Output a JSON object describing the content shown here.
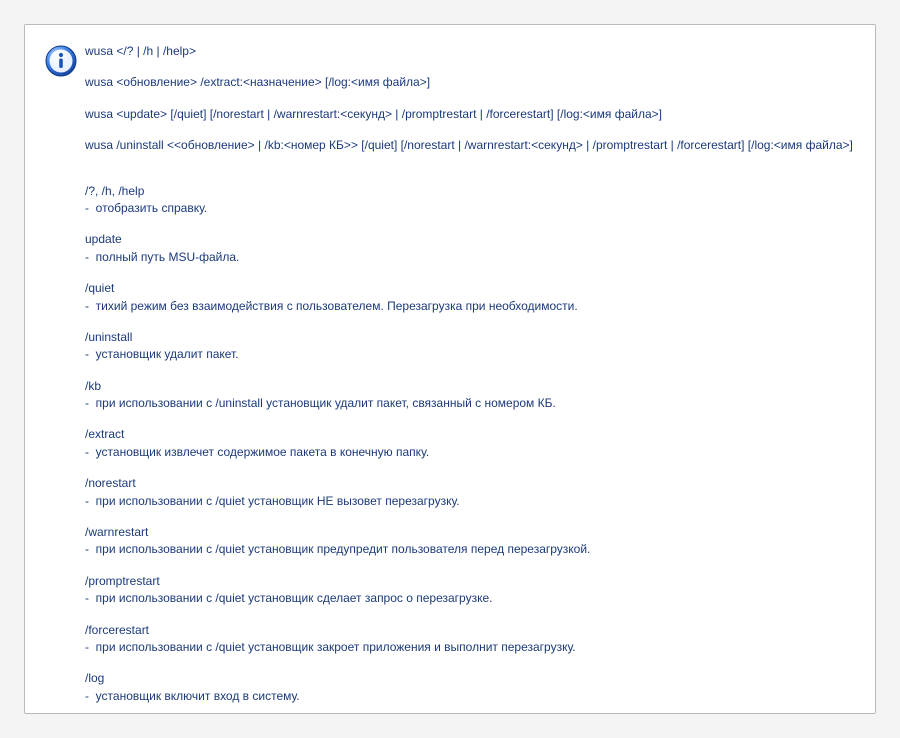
{
  "usage": [
    "wusa </? | /h | /help>",
    "wusa <обновление> /extract:<назначение> [/log:<имя файла>]",
    "wusa <update> [/quiet] [/norestart | /warnrestart:<секунд> | /promptrestart | /forcerestart] [/log:<имя файла>]",
    "wusa /uninstall <<обновление> | /kb:<номер КБ>> [/quiet] [/norestart | /warnrestart:<секунд> | /promptrestart | /forcerestart] [/log:<имя файла>]"
  ],
  "options": [
    {
      "name": "/?, /h, /help",
      "desc": "отобразить справку."
    },
    {
      "name": "update",
      "desc": "полный путь MSU-файла."
    },
    {
      "name": "/quiet",
      "desc": "тихий режим без взаимодействия с пользователем. Перезагрузка при необходимости."
    },
    {
      "name": "/uninstall",
      "desc": "установщик удалит пакет."
    },
    {
      "name": "/kb",
      "desc": "при использовании с /uninstall установщик удалит пакет, связанный с номером КБ."
    },
    {
      "name": "/extract",
      "desc": "установщик извлечет содержимое пакета в конечную папку."
    },
    {
      "name": "/norestart",
      "desc": "при использовании с /quiet установщик НЕ вызовет перезагрузку."
    },
    {
      "name": "/warnrestart",
      "desc": "при использовании с /quiet установщик предупредит пользователя перед перезагрузкой."
    },
    {
      "name": "/promptrestart",
      "desc": "при использовании с /quiet установщик сделает запрос о перезагрузке."
    },
    {
      "name": "/forcerestart",
      "desc": "при использовании с /quiet установщик закроет приложения и выполнит перезагрузку."
    },
    {
      "name": "/log",
      "desc": "установщик включит вход в систему."
    }
  ]
}
